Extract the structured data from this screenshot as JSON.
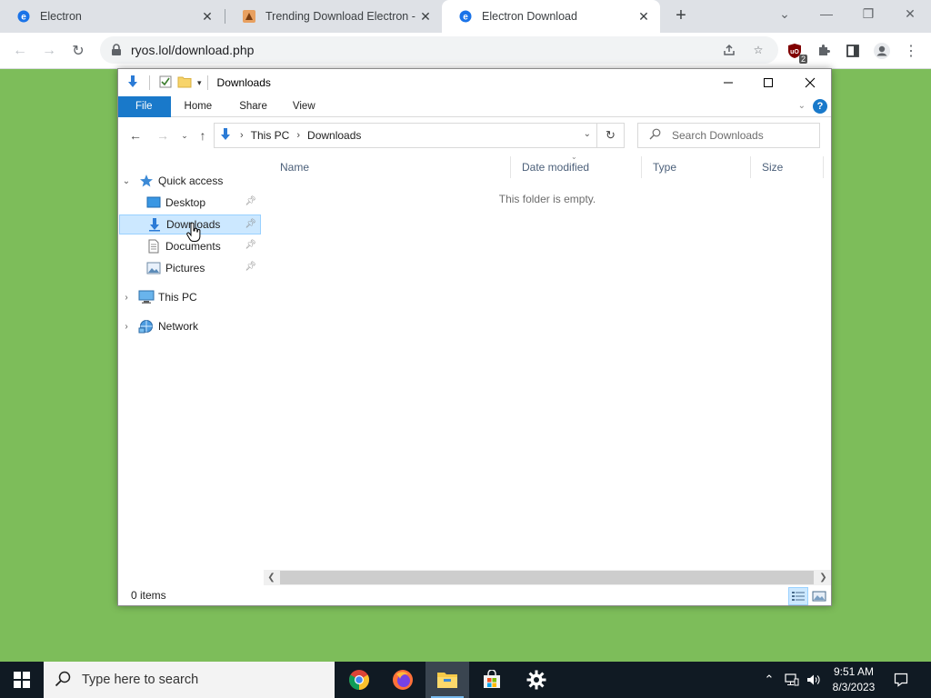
{
  "browser": {
    "tabs": [
      {
        "title": "Electron",
        "active": false
      },
      {
        "title": "Trending Download Electron - Ry",
        "active": false
      },
      {
        "title": "Electron Download",
        "active": true
      }
    ],
    "url": "ryos.lol/download.php",
    "extension_badge": "2"
  },
  "explorer": {
    "title": "Downloads",
    "ribbon_tabs": [
      "File",
      "Home",
      "Share",
      "View"
    ],
    "help_label": "?",
    "breadcrumb": [
      "This PC",
      "Downloads"
    ],
    "search_placeholder": "Search Downloads",
    "nav": {
      "quick_access": "Quick access",
      "quick_items": [
        "Desktop",
        "Downloads",
        "Documents",
        "Pictures"
      ],
      "this_pc": "This PC",
      "network": "Network"
    },
    "columns": [
      "Name",
      "Date modified",
      "Type",
      "Size"
    ],
    "empty_message": "This folder is empty.",
    "status": "0 items"
  },
  "taskbar": {
    "search_placeholder": "Type here to search",
    "time": "9:51 AM",
    "date": "8/3/2023"
  },
  "colors": {
    "desktop_bg": "#7dbd5a",
    "file_tab": "#1979ca",
    "selection": "#cce8ff",
    "taskbar": "#101a23"
  }
}
